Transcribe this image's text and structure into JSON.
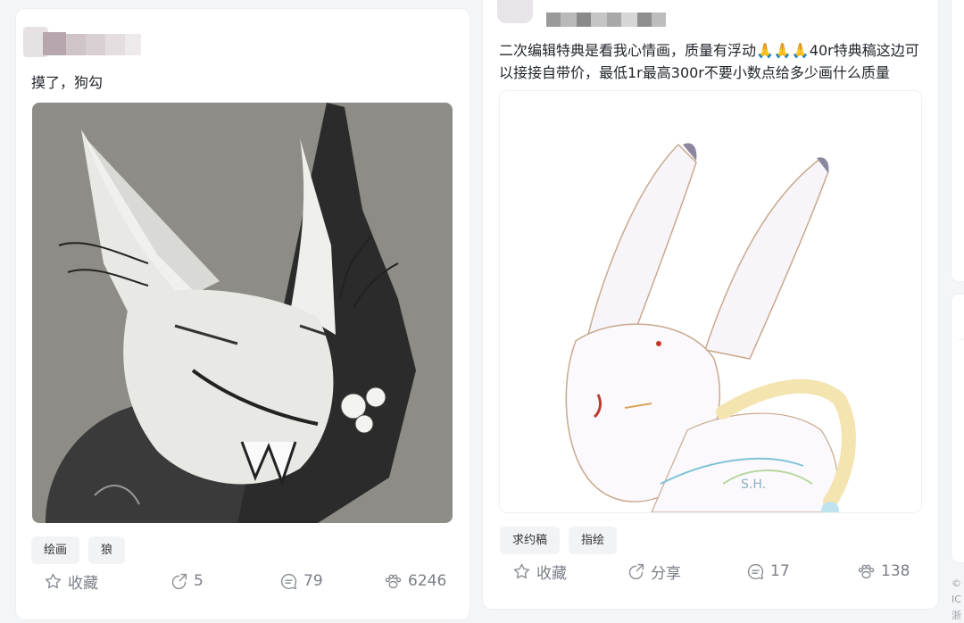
{
  "posts": [
    {
      "text": "摸了，狗勾",
      "tags": [
        "绘画",
        "狼"
      ],
      "actions": {
        "favorite": "收藏",
        "share": "5",
        "comments": "79",
        "likes": "6246"
      },
      "image_icon": "sketch-wolf-illustration"
    },
    {
      "text": "二次编辑特典是看我心情画，质量有浮动🙏🙏🙏40r特典稿这边可以接接自带价，最低1r最高300r不要小数点给多少画什么质量",
      "tags": [
        "求约稿",
        "指绘"
      ],
      "actions": {
        "favorite": "收藏",
        "share": "分享",
        "comments": "17",
        "likes": "138"
      },
      "watermark": "S.H.",
      "image_icon": "white-rabbit-illustration"
    }
  ],
  "footer": {
    "line1": "©",
    "line2": "IC",
    "line3": "浙"
  },
  "colors": {
    "card_bg": "#ffffff",
    "page_bg": "#f4f5f7",
    "tag_bg": "#f2f3f5",
    "action_text": "#7a7f87",
    "wolf_image_bg": "#8d8c86"
  }
}
